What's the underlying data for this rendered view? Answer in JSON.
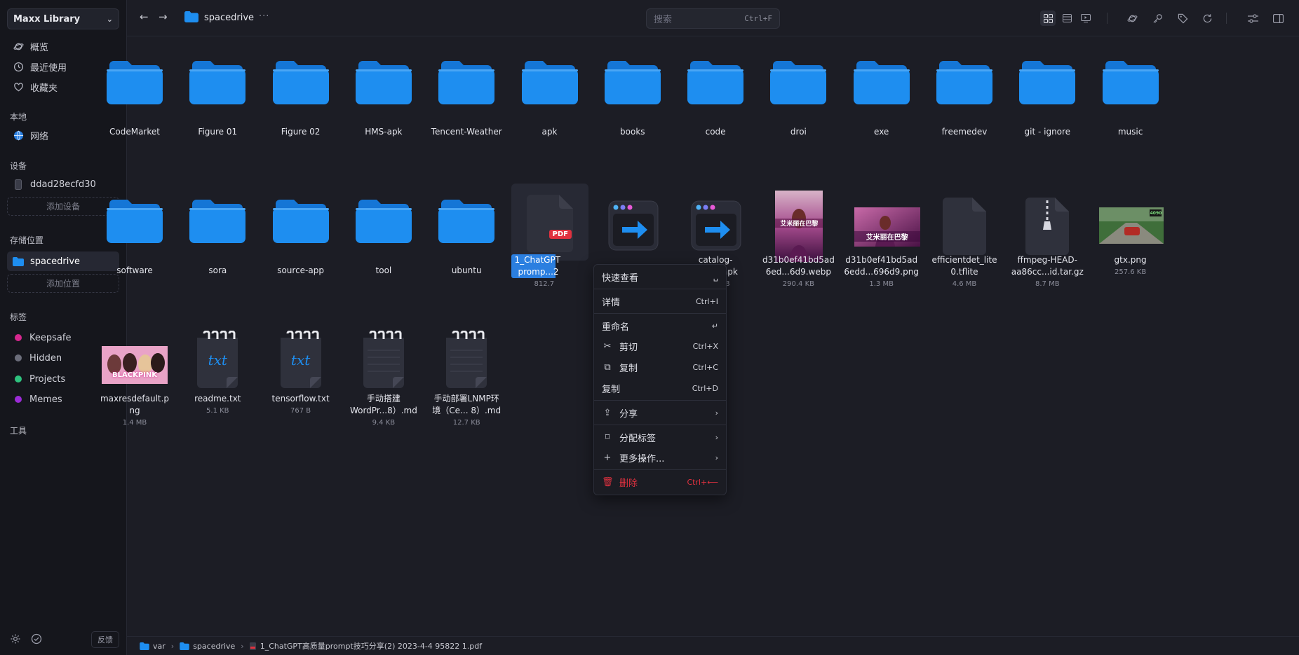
{
  "sidebar": {
    "library": "Maxx Library",
    "nav": [
      {
        "label": "概览",
        "icon": "planet-icon"
      },
      {
        "label": "最近使用",
        "icon": "clock-icon"
      },
      {
        "label": "收藏夹",
        "icon": "heart-icon"
      }
    ],
    "local_heading": "本地",
    "network": "网络",
    "devices_heading": "设备",
    "device": "ddad28ecfd30",
    "add_device": "添加设备",
    "locations_heading": "存储位置",
    "location": "spacedrive",
    "add_location": "添加位置",
    "tags_heading": "标签",
    "tags": [
      {
        "label": "Keepsafe",
        "color": "#d6278e"
      },
      {
        "label": "Hidden",
        "color": "#6b6d7a"
      },
      {
        "label": "Projects",
        "color": "#2ec27e"
      },
      {
        "label": "Memes",
        "color": "#9b2bd6"
      }
    ],
    "tools_heading": "工具",
    "feedback": "反馈"
  },
  "topbar": {
    "title": "spacedrive",
    "more": "···",
    "search_placeholder": "搜索",
    "search_shortcut": "Ctrl+F"
  },
  "colors": {
    "accent": "#2b7fe0",
    "folder": "#1e8ef0",
    "danger": "#e0313f"
  },
  "files_row1": [
    {
      "name": "CodeMarket"
    },
    {
      "name": "Figure 01"
    },
    {
      "name": "Figure 02"
    },
    {
      "name": "HMS-apk"
    },
    {
      "name": "Tencent-Weather"
    },
    {
      "name": "apk"
    },
    {
      "name": "books"
    },
    {
      "name": "code"
    },
    {
      "name": "droi"
    },
    {
      "name": "exe"
    },
    {
      "name": "freemedev"
    },
    {
      "name": "git - ignore"
    },
    {
      "name": "music"
    }
  ],
  "files_row2": [
    {
      "name": "software"
    },
    {
      "name": "sora"
    },
    {
      "name": "source-app"
    },
    {
      "name": "tool"
    },
    {
      "name": "ubuntu"
    }
  ],
  "files_row2_files": [
    {
      "name1": "1_ChatGPT",
      "name2": "promp...2",
      "size": "812.7",
      "kind": "pdf",
      "badge": "PDF"
    },
    {
      "name1": "",
      "name2": "",
      "size": "",
      "kind": "app"
    },
    {
      "name1": "catalog-",
      "name2": "debug.apk",
      "size": "14.9 MB",
      "kind": "app"
    },
    {
      "name1": "d31b0ef41bd5ad",
      "name2": "6ed...6d9.webp",
      "size": "290.4 KB",
      "kind": "poster"
    },
    {
      "name1": "d31b0ef41bd5ad",
      "name2": "6edd...696d9.png",
      "size": "1.3 MB",
      "kind": "poster-wide"
    },
    {
      "name1": "efficientdet_lite",
      "name2": "0.tflite",
      "size": "4.6 MB",
      "kind": "blank"
    },
    {
      "name1": "ffmpeg-HEAD-",
      "name2": "aa86cc...id.tar.gz",
      "size": "8.7 MB",
      "kind": "zip"
    },
    {
      "name1": "gtx.png",
      "name2": "",
      "size": "257.6 KB",
      "kind": "photo"
    }
  ],
  "files_row3": [
    {
      "name1": "maxresdefault.p",
      "name2": "ng",
      "size": "1.4 MB",
      "kind": "blackpink"
    },
    {
      "name1": "readme.txt",
      "name2": "",
      "size": "5.1 KB",
      "kind": "txt"
    },
    {
      "name1": "tensorflow.txt",
      "name2": "",
      "size": "767 B",
      "kind": "txt"
    },
    {
      "name1": "手动搭建",
      "name2": "WordPr...8）.md",
      "size": "9.4 KB",
      "kind": "note"
    },
    {
      "name1": "手动部署LNMP环",
      "name2": "境（Ce... 8）.md",
      "size": "12.7 KB",
      "kind": "note"
    }
  ],
  "thumb_text": {
    "poster_caption": "艾米丽在巴黎",
    "blackpink": "BLACKPINK",
    "txt_glyph": "txt",
    "gpu_badge": "4090"
  },
  "context_menu": {
    "items": [
      {
        "label": "快速查看",
        "shortcut": "␣",
        "icon": ""
      },
      {
        "label": "详情",
        "shortcut": "Ctrl+I",
        "icon": ""
      },
      {
        "label": "重命名",
        "shortcut": "↵",
        "icon": ""
      },
      {
        "label": "剪切",
        "shortcut": "Ctrl+X",
        "icon": "✂"
      },
      {
        "label": "复制",
        "shortcut": "Ctrl+C",
        "icon": "⧉"
      },
      {
        "label": "复制",
        "shortcut": "Ctrl+D",
        "icon": ""
      },
      {
        "label": "分享",
        "shortcut": "›",
        "icon": "⇪"
      },
      {
        "label": "分配标签",
        "shortcut": "›",
        "icon": "⌑"
      },
      {
        "label": "更多操作...",
        "shortcut": "›",
        "icon": "+"
      },
      {
        "label": "删除",
        "shortcut": "Ctrl+⟵",
        "icon": "🗑"
      }
    ]
  },
  "footer": {
    "path": [
      "var",
      "spacedrive"
    ],
    "file": "1_ChatGPT高质量prompt技巧分享(2) 2023-4-4 95822 1.pdf"
  }
}
